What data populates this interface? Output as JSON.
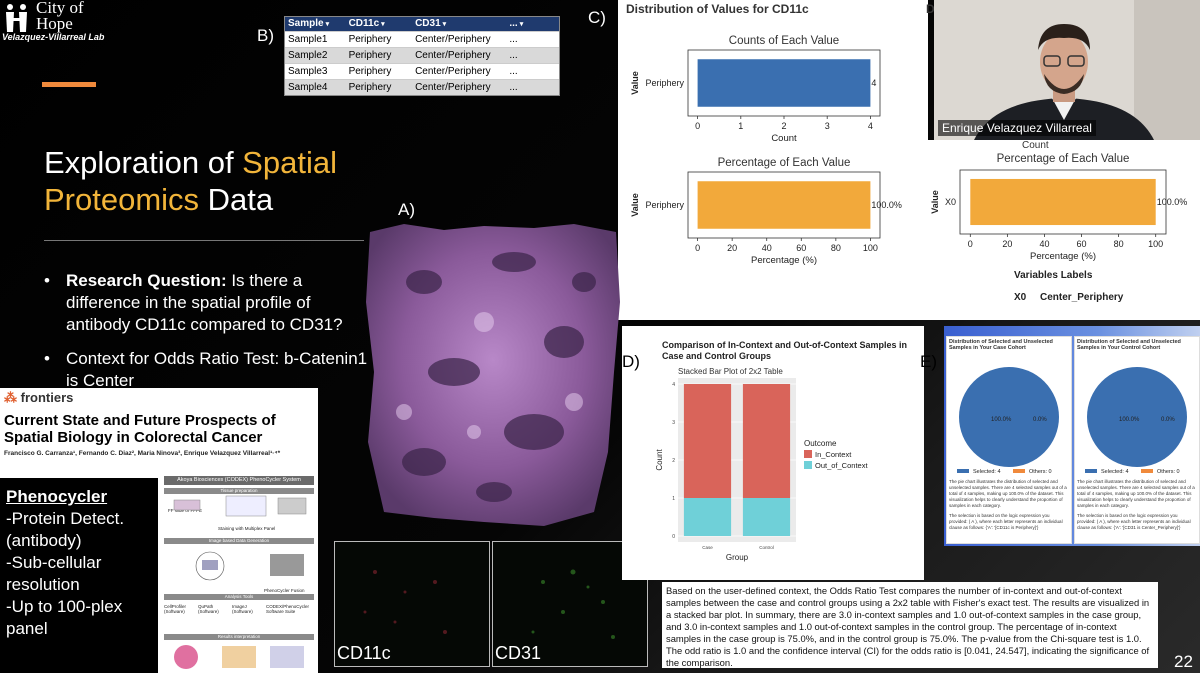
{
  "header": {
    "logo_text": "City of Hope",
    "lab_name": "Velazquez-Villarreal Lab"
  },
  "slide": {
    "title_part1": "Exploration of ",
    "title_highlight1": "Spatial",
    "title_highlight2": "Proteomics",
    "title_part2": " Data",
    "bullets": [
      {
        "bold": "Research Question:",
        "text": " Is there a difference in the spatial profile of antibody CD11c compared to CD31?"
      },
      {
        "bold": "",
        "text": "Context for Odds Ratio Test: b-Catenin1 is Center"
      }
    ],
    "slide_number": "22"
  },
  "labels": {
    "a": "A)",
    "b": "B)",
    "c": "C)",
    "d": "D)",
    "e": "E)"
  },
  "table_b": {
    "headers": [
      "Sample",
      "CD11c",
      "CD31",
      "..."
    ],
    "rows": [
      [
        "Sample1",
        "Periphery",
        "Center/Periphery",
        "..."
      ],
      [
        "Sample2",
        "Periphery",
        "Center/Periphery",
        "..."
      ],
      [
        "Sample3",
        "Periphery",
        "Center/Periphery",
        "..."
      ],
      [
        "Sample4",
        "Periphery",
        "Center/Periphery",
        "..."
      ]
    ]
  },
  "panel_c": {
    "heading": "Distribution of Values for CD11c",
    "heading2_initial": "D",
    "counts_chart": {
      "title": "Counts of Each Value",
      "ylabel": "Value",
      "xlabel": "Count",
      "category": "Periphery",
      "value": 4,
      "value_label": "4",
      "ticks": [
        "0",
        "1",
        "2",
        "3",
        "4"
      ]
    },
    "percent_chart": {
      "title": "Percentage of Each Value",
      "ylabel": "Value",
      "xlabel": "Percentage (%)",
      "category": "Periphery",
      "value": 100,
      "value_label": "100.0%",
      "ticks": [
        "0",
        "20",
        "40",
        "60",
        "80",
        "100"
      ]
    },
    "right_chart": {
      "title": "Percentage of Each Value",
      "ylabel": "Value",
      "xlabel": "Percentage (%)",
      "category": "X0",
      "value": 100,
      "value_label": "100.0%",
      "ticks": [
        "0",
        "20",
        "40",
        "60",
        "80",
        "100"
      ],
      "partial_axis_label": "Count"
    },
    "variables_header": "Variables Labels",
    "variable_key": "X0",
    "variable_value": "Center_Periphery",
    "colors": {
      "counts_bar": "#3a6fb0",
      "percent_bar": "#f2a93b"
    }
  },
  "video": {
    "participant_name": "Enrique Velazquez Villarreal"
  },
  "images": {
    "cd11c_label": "CD11c",
    "cd31_label": "CD31"
  },
  "article": {
    "journal": "frontiers",
    "title": "Current State and Future Prospects of Spatial Biology in Colorectal Cancer",
    "authors": "Francisco G. Carranza¹, Fernando C. Diaz², Maria Ninova³, Enrique Velazquez Villarreal¹·⁴*",
    "workflow_title": "Akoya Biosciences (CODEX) PhenoCycler System",
    "workflow_bands": [
      "Tissue preparation",
      "Image based Data Generation",
      "Analysis Tools",
      "Results interpretation"
    ],
    "workflow_items": [
      "FF slide or FFPE",
      "Staining with Multiplex Panel",
      "PhenoCycler Fusion",
      "CellProfiler (Software)",
      "QuPath (Software)",
      "ImageJ (Software)",
      "CODEX/PhenoCycler Software Suite"
    ]
  },
  "phenocycler": {
    "heading": "Phenocycler",
    "lines": [
      "-Protein Detect.",
      "(antibody)",
      "-Sub-cellular",
      "resolution",
      "-Up to 100-plex",
      "panel"
    ]
  },
  "panel_d": {
    "title": "Comparison of In-Context and Out-of-Context Samples in Case and Control Groups",
    "chart_title": "Stacked Bar Plot of 2x2 Table",
    "ylabel": "Count",
    "xlabel": "Group",
    "legend_title": "Outcome",
    "colors": {
      "in_context": "#d9645a",
      "out_of_context": "#6fd0d8"
    }
  },
  "chart_data": [
    {
      "type": "bar",
      "title": "Counts of Each Value",
      "categories": [
        "Periphery"
      ],
      "values": [
        4
      ],
      "xlabel": "Count",
      "ylabel": "Value",
      "xlim": [
        0,
        4
      ]
    },
    {
      "type": "bar",
      "title": "Percentage of Each Value",
      "categories": [
        "Periphery"
      ],
      "values": [
        100
      ],
      "xlabel": "Percentage (%)",
      "ylabel": "Value",
      "xlim": [
        0,
        100
      ]
    },
    {
      "type": "bar",
      "title": "Percentage of Each Value",
      "categories": [
        "X0"
      ],
      "values": [
        100
      ],
      "xlabel": "Percentage (%)",
      "ylabel": "Value",
      "xlim": [
        0,
        100
      ]
    },
    {
      "type": "bar",
      "title": "Stacked Bar Plot of 2x2 Table",
      "categories": [
        "Case",
        "Control"
      ],
      "series": [
        {
          "name": "In_Context",
          "values": [
            3,
            3
          ]
        },
        {
          "name": "Out_of_Context",
          "values": [
            1,
            1
          ]
        }
      ],
      "xlabel": "Group",
      "ylabel": "Count",
      "ylim": [
        0,
        4
      ],
      "yticks": [
        "0",
        "1",
        "2",
        "3",
        "4"
      ]
    },
    {
      "type": "pie",
      "title": "Distribution of Selected and Unselected Samples in Your Case Cohort",
      "categories": [
        "Selected: 4",
        "Others: 0"
      ],
      "values": [
        100,
        0
      ],
      "labels": [
        "100.0%",
        "0.0%"
      ]
    },
    {
      "type": "pie",
      "title": "Distribution of Selected and Unselected Samples in Your Control Cohort",
      "categories": [
        "Selected: 4",
        "Others: 0"
      ],
      "values": [
        100,
        0
      ],
      "labels": [
        "100.0%",
        "0.0%"
      ]
    }
  ],
  "panel_e": {
    "case": {
      "title": "Distribution of Selected and Unselected Samples in Your Case Cohort",
      "legend_selected": "Selected: 4",
      "legend_others": "Others: 0",
      "pct_selected": "100.0%",
      "pct_others": "0.0%",
      "desc": "The pie chart illustrates the distribution of selected and unselected samples. There are 4 selected samples out of a total of 4 samples, making up 100.0% of the dataset. This visualization helps to clearly understand the proportion of samples in each category.",
      "logic": "The selection is based on the logic expression you provided: ( A ), where each letter represents an individual clause as follows: {'A': '[CD11c is Periphery]'}"
    },
    "control": {
      "title": "Distribution of Selected and Unselected Samples in Your Control Cohort",
      "legend_selected": "Selected: 4",
      "legend_others": "Others: 0",
      "pct_selected": "100.0%",
      "pct_others": "0.0%",
      "desc": "The pie chart illustrates the distribution of selected and unselected samples. There are 4 selected samples out of a total of 4 samples, making up 100.0% of the dataset. This visualization helps to clearly understand the proportion of samples in each category.",
      "logic": "The selection is based on the logic expression you provided: ( A ), where each letter represents an individual clause as follows: {'A': '[CD31 is Center_Periphery]'}"
    },
    "colors": {
      "selected": "#3a6fb0",
      "others": "#f08a3c"
    }
  },
  "summary_text": "Based on the user-defined context, the Odds Ratio Test compares the number of in-context and out-of-context samples between the case and control groups using a 2x2 table with Fisher's exact test. The results are visualized in a stacked bar plot. In summary, there are 3.0 in-context samples and 1.0 out-of-context samples in the case group, and 3.0 in-context samples and 1.0 out-of-context samples in the control group. The percentage of in-context samples in the case group is 75.0%, and in the control group is 75.0%. The p-value from the Chi-square test is 1.0. The odd ratio is 1.0 and the confidence interval (CI) for the odds ratio is [0.041, 24.547], indicating the significance of the comparison."
}
